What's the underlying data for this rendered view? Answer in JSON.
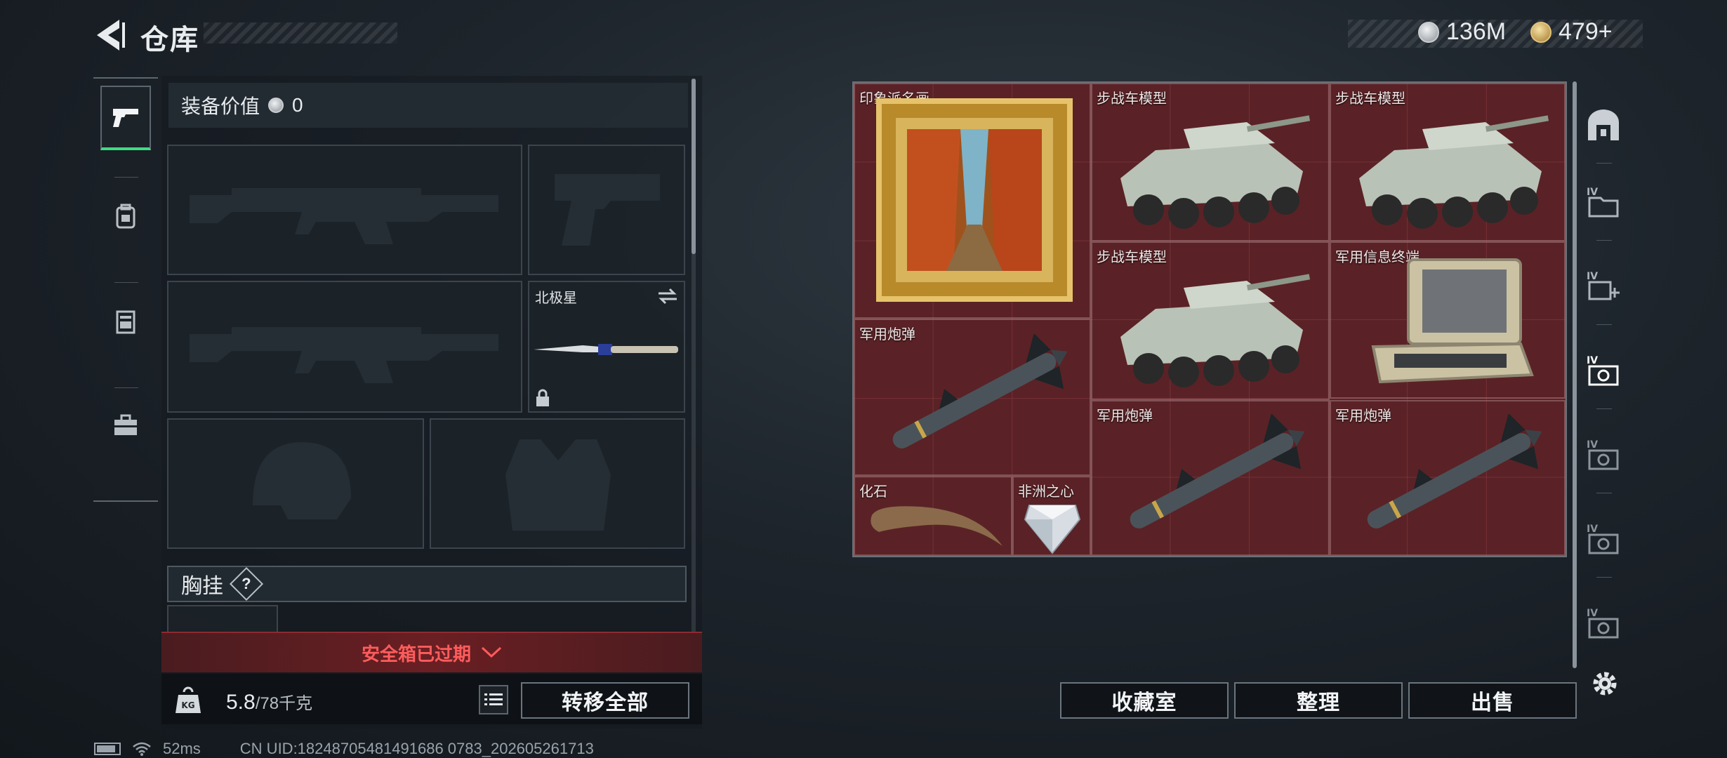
{
  "header": {
    "title": "仓库",
    "currency": [
      {
        "amount": "136M",
        "icon": "silver-coin-icon"
      },
      {
        "amount": "479+",
        "icon": "gold-coin-icon"
      }
    ]
  },
  "sidebar": {
    "tabs": [
      {
        "icon": "pistol-icon",
        "active": true
      },
      {
        "icon": "backpack-icon",
        "active": false
      },
      {
        "icon": "storage-crate-icon",
        "active": false
      },
      {
        "icon": "toolbox-icon",
        "active": false
      }
    ]
  },
  "loadout": {
    "equip_value_label": "装备价值",
    "equip_value": "0",
    "melee_name": "北极星",
    "chest_rig_label": "胸挂",
    "chest_rig_help": "?",
    "safe_box_status": "安全箱已过期",
    "weight_current": "5.8",
    "weight_max": "/78千克",
    "transfer_all": "转移全部"
  },
  "storage": {
    "items": [
      {
        "id": "painting",
        "label": "印象派名画",
        "icon": "painting-icon"
      },
      {
        "id": "ifv1",
        "label": "步战车模型",
        "icon": "armored-vehicle-icon"
      },
      {
        "id": "ifv2",
        "label": "步战车模型",
        "icon": "armored-vehicle-icon"
      },
      {
        "id": "ifv3",
        "label": "步战车模型",
        "icon": "armored-vehicle-icon"
      },
      {
        "id": "terminal",
        "label": "军用信息终端",
        "icon": "laptop-case-icon"
      },
      {
        "id": "shell1",
        "label": "军用炮弹",
        "icon": "missile-icon"
      },
      {
        "id": "shell2",
        "label": "军用炮弹",
        "icon": "missile-icon"
      },
      {
        "id": "shell3",
        "label": "军用炮弹",
        "icon": "missile-icon"
      },
      {
        "id": "fossil",
        "label": "化石",
        "icon": "claw-fossil-icon"
      },
      {
        "id": "heart",
        "label": "非洲之心",
        "icon": "diamond-icon"
      }
    ],
    "buttons": {
      "collection": "收藏室",
      "organize": "整理",
      "sell": "出售"
    }
  },
  "right_tabs": [
    {
      "icon": "vault-icon"
    },
    {
      "icon": "storage-iv-folder-icon"
    },
    {
      "icon": "storage-iv-add-icon"
    },
    {
      "icon": "storage-iv-active-icon"
    },
    {
      "icon": "storage-iv-2-icon"
    },
    {
      "icon": "storage-iv-3-icon"
    },
    {
      "icon": "storage-iv-4-icon"
    },
    {
      "icon": "settings-gear-icon"
    }
  ],
  "footer": {
    "ping": "52ms",
    "uid": "CN UID:18248705481491686 0783_202605261713"
  },
  "colors": {
    "accent_green": "#3ddc84",
    "alert_red": "#ff5c5c",
    "storage_bg": "#5a2226"
  }
}
